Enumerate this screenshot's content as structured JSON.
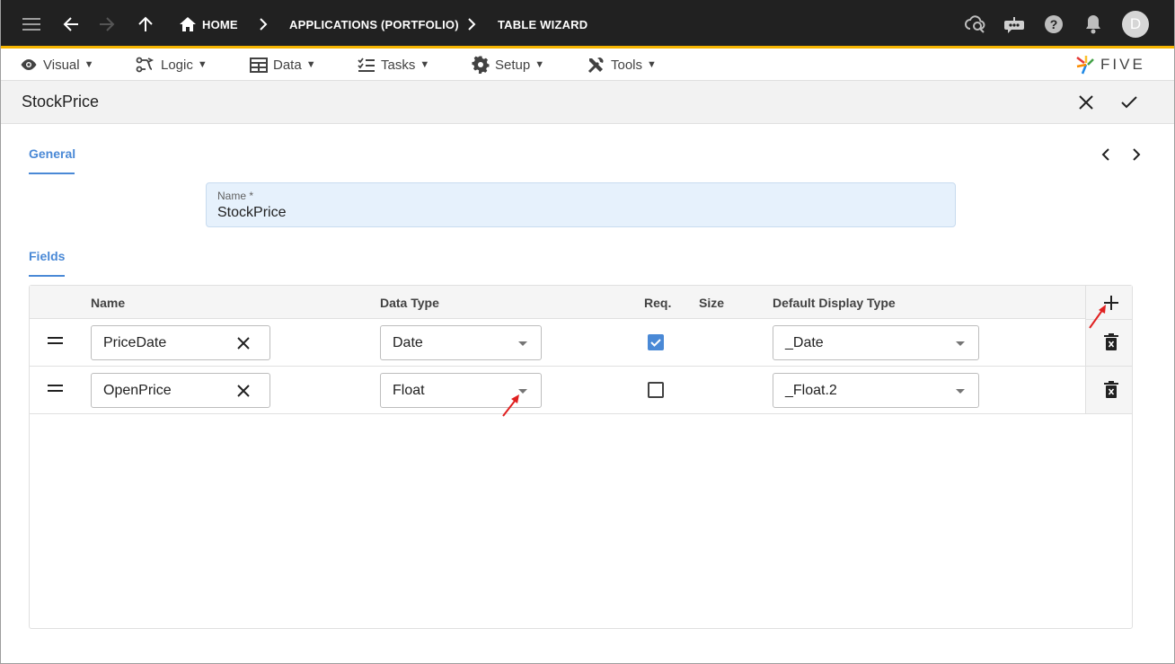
{
  "breadcrumbs": [
    "HOME",
    "APPLICATIONS (PORTFOLIO)",
    "TABLE WIZARD"
  ],
  "user_initial": "D",
  "menu": [
    {
      "label": "Visual",
      "icon": "eye-icon"
    },
    {
      "label": "Logic",
      "icon": "logic-flow-icon"
    },
    {
      "label": "Data",
      "icon": "table-grid-icon"
    },
    {
      "label": "Tasks",
      "icon": "checklist-icon"
    },
    {
      "label": "Setup",
      "icon": "gear-icon"
    },
    {
      "label": "Tools",
      "icon": "tools-icon"
    }
  ],
  "logo_text": "FIVE",
  "form_title": "StockPrice",
  "tabs": {
    "general": "General",
    "fields": "Fields"
  },
  "name_field": {
    "label": "Name *",
    "value": "StockPrice"
  },
  "table": {
    "headers": {
      "name": "Name",
      "data_type": "Data Type",
      "req": "Req.",
      "size": "Size",
      "display_type": "Default Display Type"
    },
    "rows": [
      {
        "name": "PriceDate",
        "data_type": "Date",
        "required": true,
        "size": "",
        "display_type": "_Date"
      },
      {
        "name": "OpenPrice",
        "data_type": "Float",
        "required": false,
        "size": "",
        "display_type": "_Float.2"
      }
    ]
  },
  "colors": {
    "appbar": "#212121",
    "accent_bar": "#f5b400",
    "primary": "#4a89d6",
    "annotation_arrow": "#e02020"
  }
}
